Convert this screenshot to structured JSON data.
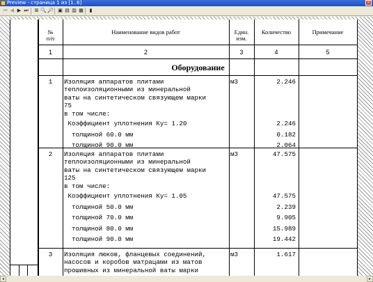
{
  "window": {
    "title": "Preview - страница 1 из [1..6]"
  },
  "toolbar": {
    "buttons": [
      {
        "icon": "first-page-icon",
        "glyph": "⏮",
        "enabled": false
      },
      {
        "icon": "prev-page-icon",
        "glyph": "◀",
        "enabled": false
      },
      {
        "icon": "next-page-icon",
        "glyph": "▶",
        "enabled": true
      },
      {
        "icon": "last-page-icon",
        "glyph": "⏭",
        "enabled": true
      },
      {
        "icon": "zoom-fit-icon",
        "glyph": "⊞",
        "enabled": true
      },
      {
        "icon": "zoom-in-icon",
        "glyph": "🔍",
        "enabled": true
      },
      {
        "icon": "zoom-out-icon",
        "glyph": "🔎",
        "enabled": true
      },
      {
        "icon": "print-icon",
        "glyph": "▣",
        "enabled": true
      },
      {
        "icon": "setup-icon",
        "glyph": "▤",
        "enabled": true
      },
      {
        "icon": "save-icon",
        "glyph": "▥",
        "enabled": true
      },
      {
        "icon": "export-icon",
        "glyph": "▦",
        "enabled": true
      },
      {
        "icon": "close-preview-icon",
        "glyph": "▮",
        "enabled": true
      }
    ]
  },
  "table": {
    "headers": {
      "num": "№\nп/п",
      "name": "Наименование видов работ",
      "unit": "Един.\nизм.",
      "qty": "Количество",
      "note": "Примечание"
    },
    "col_numbers": [
      "1",
      "2",
      "3",
      "4",
      "5"
    ],
    "section_title": "Оборудование",
    "rows": [
      {
        "num": "1",
        "lines": [
          "Изоляция аппаратов плитами",
          "теплоизоляционными из минеральной",
          "ваты на синтетическом связующем марки",
          "75",
          "в том числе:"
        ],
        "unit": "м3",
        "qty": "2.246",
        "subs": [
          {
            "label": " Коэффициент уплотнения Ку= 1.20",
            "qty": "2.246"
          },
          {
            "label": "  толщиной 60.0 мм",
            "qty": "0.182"
          },
          {
            "label": "  толщиной 90.0 мм",
            "qty": "2.064"
          }
        ]
      },
      {
        "num": "2",
        "lines": [
          "Изоляция аппаратов плитами",
          "теплоизоляционными из минеральной",
          "ваты на синтетическом связующем марки",
          "125",
          "в том числе:"
        ],
        "unit": "м3",
        "qty": "47.575",
        "subs": [
          {
            "label": " Коэффициент уплотнения Ку= 1.05",
            "qty": "47.575"
          },
          {
            "label": "  толщиной 50.0 мм",
            "qty": "2.239"
          },
          {
            "label": "  толщиной 70.0 мм",
            "qty": "9.905"
          },
          {
            "label": "  толщиной 80.0 мм",
            "qty": "15.989"
          },
          {
            "label": "  толщиной 90.0 мм",
            "qty": "19.442"
          }
        ]
      },
      {
        "num": "3",
        "lines": [
          "Изоляция люков, фланцевых соединений,",
          "насосов и коробов матрацами из матов",
          "прошивных из минеральной ваты марки"
        ],
        "unit": "м3",
        "qty": "1.617",
        "subs": []
      }
    ]
  }
}
